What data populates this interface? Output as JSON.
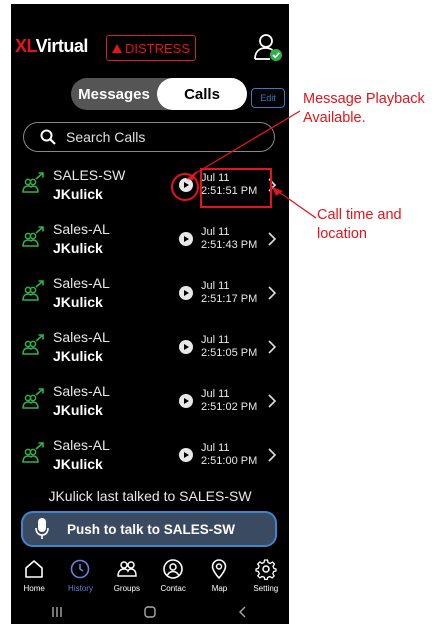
{
  "header": {
    "logo_prefix": "XL",
    "logo_suffix": "Virtual",
    "distress_label": "DISTRESS"
  },
  "tabs": {
    "messages": "Messages",
    "calls": "Calls",
    "active": "Calls",
    "edit": "Edit"
  },
  "search": {
    "placeholder": "Search Calls"
  },
  "calls": [
    {
      "channel": "SALES-SW",
      "user": "JKulick",
      "date": "Jul 11",
      "time": "2:51:51 PM",
      "has_playback": true
    },
    {
      "channel": "Sales-AL",
      "user": "JKulick",
      "date": "Jul 11",
      "time": "2:51:43 PM",
      "has_playback": true
    },
    {
      "channel": "Sales-AL",
      "user": "JKulick",
      "date": "Jul 11",
      "time": "2:51:17 PM",
      "has_playback": true
    },
    {
      "channel": "Sales-AL",
      "user": "JKulick",
      "date": "Jul 11",
      "time": "2:51:05 PM",
      "has_playback": true
    },
    {
      "channel": "Sales-AL",
      "user": "JKulick",
      "date": "Jul 11",
      "time": "2:51:02 PM",
      "has_playback": true
    },
    {
      "channel": "Sales-AL",
      "user": "JKulick",
      "date": "Jul 11",
      "time": "2:51:00 PM",
      "has_playback": true
    }
  ],
  "last_talked": "JKulick last talked to SALES-SW",
  "ptt": {
    "label": "Push to talk to SALES-SW"
  },
  "nav": [
    {
      "label": "Home",
      "icon": "home-icon",
      "active": false
    },
    {
      "label": "History",
      "icon": "clock-icon",
      "active": true
    },
    {
      "label": "Groups",
      "icon": "groups-icon",
      "active": false
    },
    {
      "label": "Contac",
      "icon": "contact-icon",
      "active": false
    },
    {
      "label": "Map",
      "icon": "map-pin-icon",
      "active": false
    },
    {
      "label": "Setting",
      "icon": "gear-icon",
      "active": false
    }
  ],
  "annotations": {
    "playback_line1": "Message Playback",
    "playback_line2": "Available.",
    "time_line1": "Call time and",
    "time_line2": "location"
  },
  "colors": {
    "accent_red": "#e3141b",
    "call_icon_green": "#2fb24a",
    "active_nav": "#6b7fe0",
    "edit_blue": "#2d7fc6",
    "ptt_bg": "#3a4a60"
  }
}
